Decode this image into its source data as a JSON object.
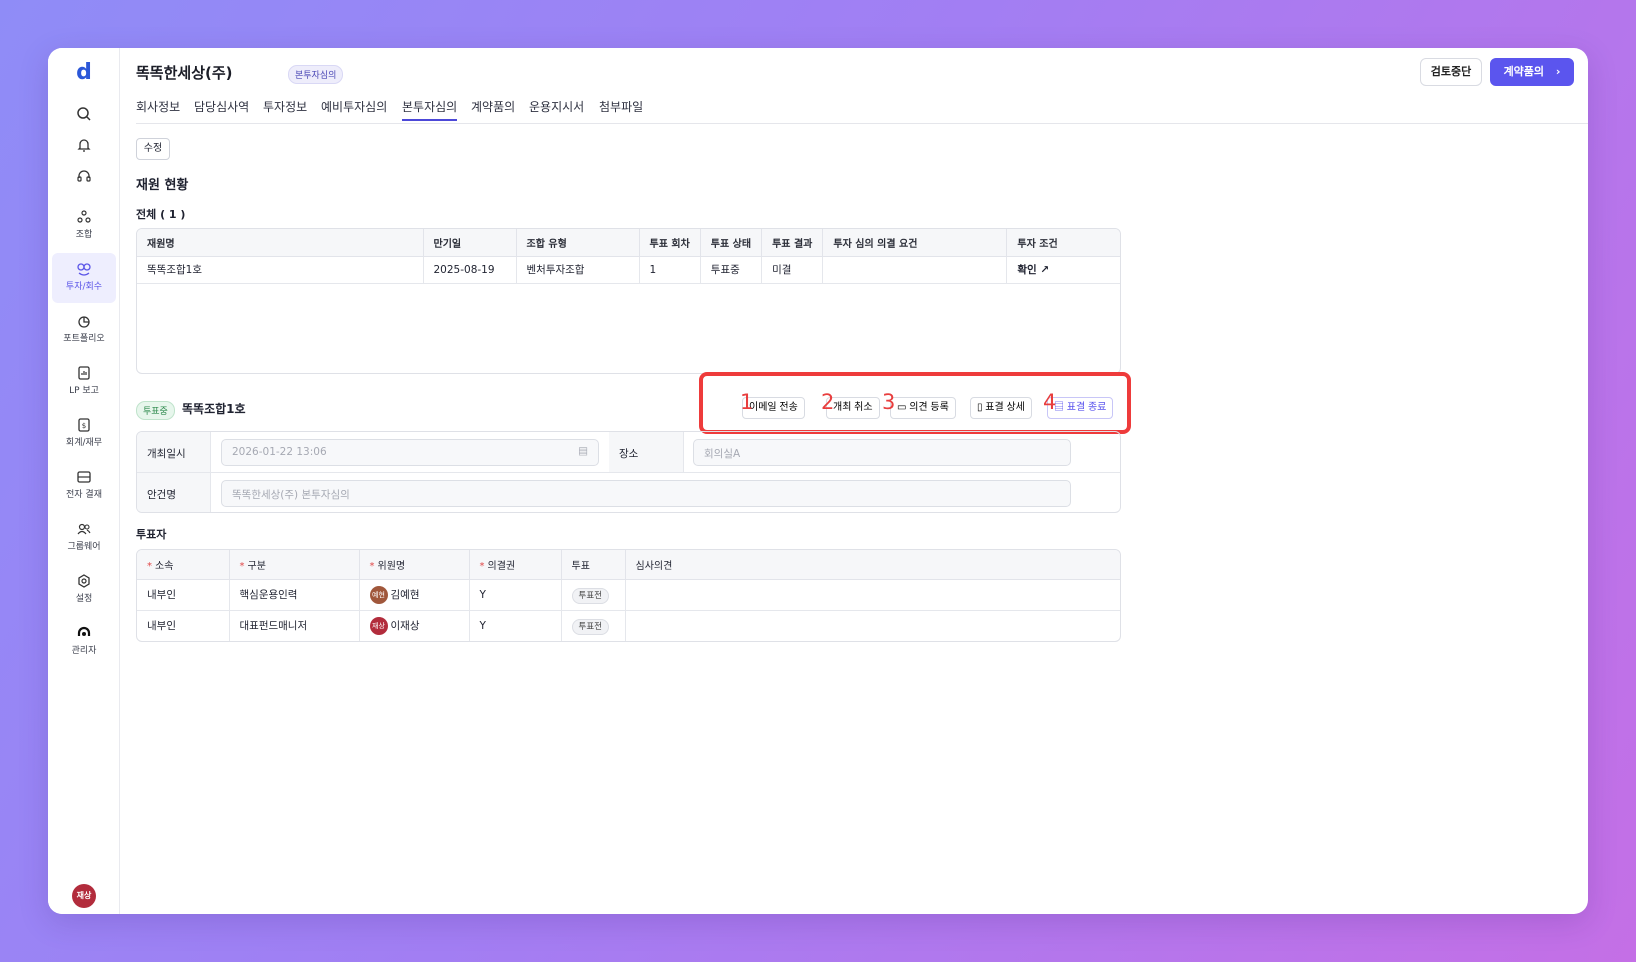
{
  "sidebar": {
    "logo": "d",
    "items": [
      {
        "label": "조합",
        "icon": "fund-icon"
      },
      {
        "label": "투자/회수",
        "icon": "invest-icon"
      },
      {
        "label": "포트폴리오",
        "icon": "portfolio-icon"
      },
      {
        "label": "LP 보고",
        "icon": "report-icon"
      },
      {
        "label": "회계/재무",
        "icon": "accounting-icon"
      },
      {
        "label": "전자 결재",
        "icon": "approval-icon"
      },
      {
        "label": "그룹웨어",
        "icon": "groupware-icon"
      },
      {
        "label": "설정",
        "icon": "settings-icon"
      },
      {
        "label": "관리자",
        "icon": "admin-icon"
      }
    ],
    "user_avatar": "재상"
  },
  "header": {
    "company": "똑똑한세상(주)",
    "stage_badge": "본투자심의",
    "stop_button": "검토중단",
    "next_button": "계약품의"
  },
  "tabs": [
    "회사정보",
    "담당심사역",
    "투자정보",
    "예비투자심의",
    "본투자심의",
    "계약품의",
    "운용지시서",
    "첨부파일"
  ],
  "edit_button": "수정",
  "fund_section": {
    "title": "재원 현황",
    "total": "전체 ( 1 )",
    "columns": [
      "재원명",
      "만기일",
      "조합 유형",
      "투표 회차",
      "투표 상태",
      "투표 결과",
      "투자 심의 의결 요건",
      "투자 조건"
    ],
    "rows": [
      {
        "name": "똑똑조합1호",
        "maturity": "2025-08-19",
        "type": "벤처투자조합",
        "round": "1",
        "status": "투표중",
        "result": "미결",
        "requirement": "",
        "condition": "확인 ↗"
      }
    ]
  },
  "meeting": {
    "status_tag": "투표중",
    "fund_name": "똑똑조합1호",
    "actions": {
      "email": "이메일 전송",
      "cancel": "개최 취소",
      "opinion": "의견 등록",
      "detail": "표결 상세",
      "end": "표결 종료"
    },
    "markers": [
      "1",
      "2",
      "3",
      "4"
    ],
    "datetime_label": "개최일시",
    "datetime_value": "2026-01-22 13:06",
    "place_label": "장소",
    "place_value": "회의실A",
    "agenda_label": "안건명",
    "agenda_value": "똑똑한세상(주) 본투자심의"
  },
  "voters": {
    "title": "투표자",
    "columns": [
      "소속",
      "구분",
      "위원명",
      "의결권",
      "투표",
      "심사의견"
    ],
    "required": [
      "*",
      "*",
      "*",
      "*"
    ],
    "rows": [
      {
        "affiliation": "내부인",
        "role": "핵심운용인력",
        "avatar": "예현",
        "avatar_color": "#a0573b",
        "name": "김예현",
        "right": "Y",
        "vote": "투표전",
        "opinion": ""
      },
      {
        "affiliation": "내부인",
        "role": "대표펀드매니저",
        "avatar": "재상",
        "avatar_color": "#b22c3c",
        "name": "이재상",
        "right": "Y",
        "vote": "투표전",
        "opinion": ""
      }
    ]
  }
}
